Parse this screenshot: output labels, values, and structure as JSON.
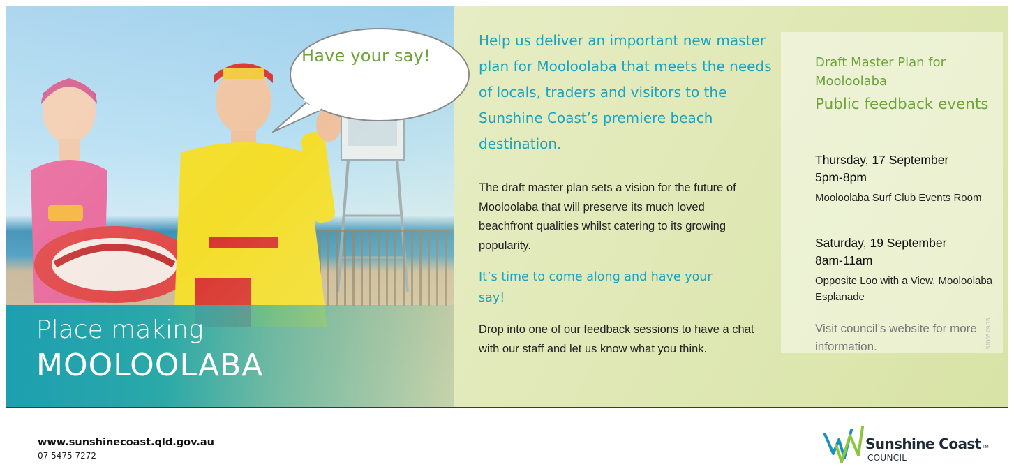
{
  "photo": {
    "speech_bubble": "Have your say!",
    "place_line1": "Place making",
    "place_line2": "MOOLOOLABA"
  },
  "main": {
    "headline": "Help us deliver an important new master plan for Mooloolaba that meets the needs of locals, traders and visitors to the Sunshine Coast’s premiere beach destination.",
    "body1": "The draft master plan sets a vision for the future of Mooloolaba that will preserve its much loved beachfront qualities whilst catering to its growing popularity.",
    "subhead": "It’s time to come along and have your say!",
    "body2": "Drop into one of our feedback sessions to have a chat with our staff and let us know what you think."
  },
  "events": {
    "title": "Draft Master Plan for Mooloolaba",
    "subtitle": "Public feedback events",
    "items": [
      {
        "date": "Thursday, 17 September",
        "time": "5pm-8pm",
        "location": "Mooloolaba Surf Club Events Room"
      },
      {
        "date": "Saturday, 19 September",
        "time": "8am-11am",
        "location": "Opposite Loo with a View, Mooloolaba Esplanade"
      }
    ],
    "visit": "Visit council’s website for more information.",
    "code": "51006 09/15"
  },
  "footer": {
    "url": "www.sunshinecoast.qld.gov.au",
    "phone": "07 5475 7272",
    "logo_name": "Sunshine Coast",
    "logo_tm": "TM",
    "logo_council": "COUNCIL"
  },
  "colors": {
    "accent_blue": "#1aa3c3",
    "accent_green": "#6ea33c",
    "band_teal": "#1d9fb0"
  }
}
